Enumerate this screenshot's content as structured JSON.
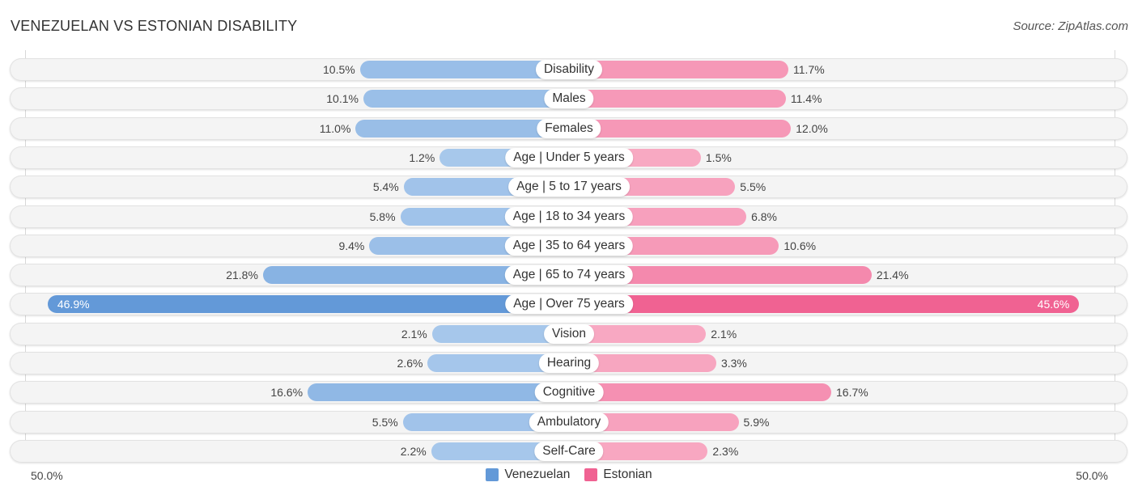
{
  "chart_data": {
    "type": "bar",
    "orientation": "horizontal-diverging",
    "title": "VENEZUELAN VS ESTONIAN DISABILITY",
    "source": "Source: ZipAtlas.com",
    "categories": [
      "Disability",
      "Males",
      "Females",
      "Age | Under 5 years",
      "Age | 5 to 17 years",
      "Age | 18 to 34 years",
      "Age | 35 to 64 years",
      "Age | 65 to 74 years",
      "Age | Over 75 years",
      "Vision",
      "Hearing",
      "Cognitive",
      "Ambulatory",
      "Self-Care"
    ],
    "series": [
      {
        "name": "Venezuelan",
        "color": "#6399d8",
        "values": [
          10.5,
          10.1,
          11.0,
          1.2,
          5.4,
          5.8,
          9.4,
          21.8,
          46.9,
          2.1,
          2.6,
          16.6,
          5.5,
          2.2
        ],
        "labels": [
          "10.5%",
          "10.1%",
          "11.0%",
          "1.2%",
          "5.4%",
          "5.8%",
          "9.4%",
          "21.8%",
          "46.9%",
          "2.1%",
          "2.6%",
          "16.6%",
          "5.5%",
          "2.2%"
        ]
      },
      {
        "name": "Estonian",
        "color": "#f06292",
        "values": [
          11.7,
          11.4,
          12.0,
          1.5,
          5.5,
          6.8,
          10.6,
          21.4,
          45.6,
          2.1,
          3.3,
          16.7,
          5.9,
          2.3
        ],
        "labels": [
          "11.7%",
          "11.4%",
          "12.0%",
          "1.5%",
          "5.5%",
          "6.8%",
          "10.6%",
          "21.4%",
          "45.6%",
          "2.1%",
          "3.3%",
          "16.7%",
          "5.9%",
          "2.3%"
        ]
      }
    ],
    "axis": {
      "left_label": "50.0%",
      "right_label": "50.0%",
      "range": [
        0,
        50
      ]
    },
    "legend": {
      "position": "bottom-center",
      "items": [
        "Venezuelan",
        "Estonian"
      ]
    }
  }
}
